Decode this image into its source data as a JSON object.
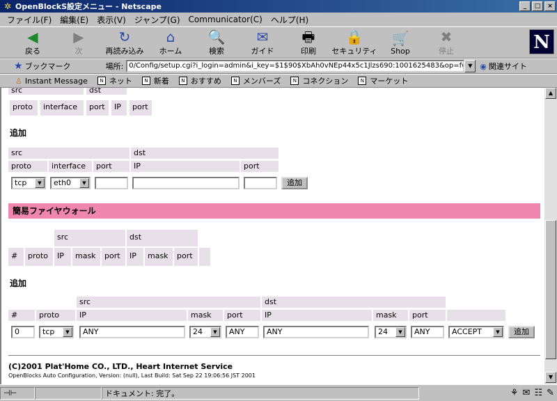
{
  "window": {
    "title": "OpenBlockS設定メニュー - Netscape"
  },
  "menu": [
    "ファイル(F)",
    "編集(E)",
    "表示(V)",
    "ジャンプ(G)",
    "Communicator(C)",
    "ヘルプ(H)"
  ],
  "toolbar": [
    {
      "label": "戻る",
      "icon": "◀",
      "enabled": true
    },
    {
      "label": "次",
      "icon": "▶",
      "enabled": false
    },
    {
      "label": "再読み込み",
      "icon": "↻",
      "enabled": true
    },
    {
      "label": "ホーム",
      "icon": "⌂",
      "enabled": true
    },
    {
      "label": "検索",
      "icon": "🔍",
      "enabled": true
    },
    {
      "label": "ガイド",
      "icon": "✉",
      "enabled": true
    },
    {
      "label": "印刷",
      "icon": "🖶",
      "enabled": true
    },
    {
      "label": "セキュリティ",
      "icon": "🔒",
      "enabled": true
    },
    {
      "label": "Shop",
      "icon": "🛒",
      "enabled": true
    },
    {
      "label": "停止",
      "icon": "✖",
      "enabled": false
    }
  ],
  "logo": "N",
  "location": {
    "bookmark_label": "ブックマーク",
    "label": "場所:",
    "url": "0/Config/setup.cgi?i_login=admin&i_key=$1$90$XbAh0vNEp44x5c1Jlzs690:1001625483&op=fw",
    "related": "関連サイト"
  },
  "personal": [
    "Instant Message",
    "ネット",
    "新着",
    "おすすめ",
    "メンバーズ",
    "コネクション",
    "マーケット"
  ],
  "page": {
    "top_table": {
      "src": "src",
      "dst": "dst",
      "cols": [
        "proto",
        "interface",
        "port",
        "IP",
        "port"
      ]
    },
    "add1": {
      "heading": "追加",
      "src": "src",
      "dst": "dst",
      "cols": [
        "proto",
        "interface",
        "port",
        "IP",
        "port"
      ],
      "proto_value": "tcp",
      "interface_value": "eth0",
      "button": "追加"
    },
    "firewall": {
      "title": "簡易ファイヤウォール",
      "src": "src",
      "dst": "dst",
      "cols": [
        "#",
        "proto",
        "IP",
        "mask",
        "port",
        "IP",
        "mask",
        "port"
      ]
    },
    "add2": {
      "heading": "追加",
      "src": "src",
      "dst": "dst",
      "cols": [
        "#",
        "proto",
        "IP",
        "mask",
        "port",
        "IP",
        "mask",
        "port"
      ],
      "num_value": "0",
      "proto_value": "tcp",
      "src_ip": "ANY",
      "src_mask": "24",
      "src_port": "ANY",
      "dst_ip": "ANY",
      "dst_mask": "24",
      "dst_port": "ANY",
      "action": "ACCEPT",
      "button": "追加"
    },
    "copyright": "(C)2001 Plat'Home CO., LTD., Heart Internet Service",
    "build": "OpenBlocks Auto Configuration, Version: (null), Last Build: Sat Sep 22 19:06:56 JST 2001"
  },
  "status": {
    "text": "ドキュメント: 完了。"
  }
}
